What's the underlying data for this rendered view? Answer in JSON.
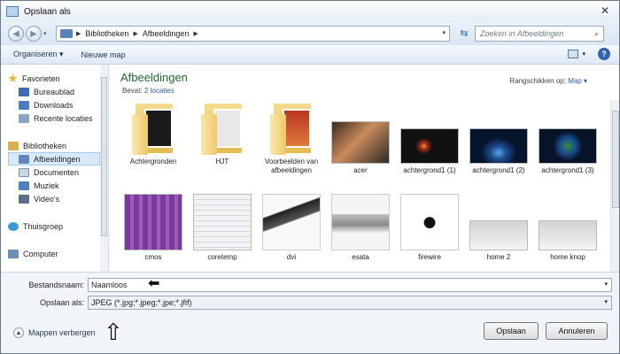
{
  "window": {
    "title": "Opslaan als"
  },
  "address": {
    "crumbs": [
      "Bibliotheken",
      "Afbeeldingen"
    ],
    "search_placeholder": "Zoeken in Afbeeldingen"
  },
  "toolbar": {
    "organize": "Organiseren ▾",
    "new_folder": "Nieuwe map"
  },
  "sidebar": {
    "items": [
      {
        "label": "Favorieten",
        "icon": "star-icon",
        "color": "#e8b33a"
      },
      {
        "label": "Bureaublad",
        "icon": "desktop-icon",
        "color": "#3f6db5"
      },
      {
        "label": "Downloads",
        "icon": "downloads-icon",
        "color": "#4a7cc2"
      },
      {
        "label": "Recente locaties",
        "icon": "recent-icon",
        "color": "#8aa4c4"
      },
      {
        "label": "Bibliotheken",
        "icon": "libraries-icon",
        "color": "#d8b04f"
      },
      {
        "label": "Afbeeldingen",
        "icon": "pictures-icon",
        "color": "#5e86b8"
      },
      {
        "label": "Documenten",
        "icon": "documents-icon",
        "color": "#c9d6e6"
      },
      {
        "label": "Muziek",
        "icon": "music-icon",
        "color": "#4e7fbf"
      },
      {
        "label": "Video's",
        "icon": "videos-icon",
        "color": "#5b6f8a"
      },
      {
        "label": "Thuisgroep",
        "icon": "homegroup-icon",
        "color": "#3a9bd6"
      },
      {
        "label": "Computer",
        "icon": "computer-icon",
        "color": "#6c8fb8"
      }
    ]
  },
  "main": {
    "title": "Afbeeldingen",
    "includes_label": "Bevat:",
    "includes_link": "2 locaties",
    "arrange_label": "Rangschikken op:",
    "arrange_value": "Map ▾",
    "items": [
      {
        "label": "Achtergronden",
        "kind": "folder"
      },
      {
        "label": "HJT",
        "kind": "folder"
      },
      {
        "label": "Voorbeelden van afbeeldingen",
        "kind": "folder"
      },
      {
        "label": "acer",
        "kind": "image"
      },
      {
        "label": "achtergrond1 (1)",
        "kind": "image"
      },
      {
        "label": "achtergrond1 (2)",
        "kind": "image"
      },
      {
        "label": "achtergrond1 (3)",
        "kind": "image"
      },
      {
        "label": "cmos",
        "kind": "image"
      },
      {
        "label": "coretemp",
        "kind": "image"
      },
      {
        "label": "dvi",
        "kind": "image"
      },
      {
        "label": "esata",
        "kind": "image"
      },
      {
        "label": "firewire",
        "kind": "image"
      },
      {
        "label": "home 2",
        "kind": "image"
      },
      {
        "label": "home knop",
        "kind": "image"
      }
    ]
  },
  "form": {
    "filename_label": "Bestandsnaam:",
    "filename_value": "Naamloos",
    "savetype_label": "Opslaan als:",
    "savetype_value": "JPEG (*.jpg;*.jpeg;*.jpe;*.jfif)"
  },
  "footer": {
    "hide_folders": "Mappen verbergen",
    "save_button": "Opslaan",
    "cancel_button": "Annuleren"
  }
}
